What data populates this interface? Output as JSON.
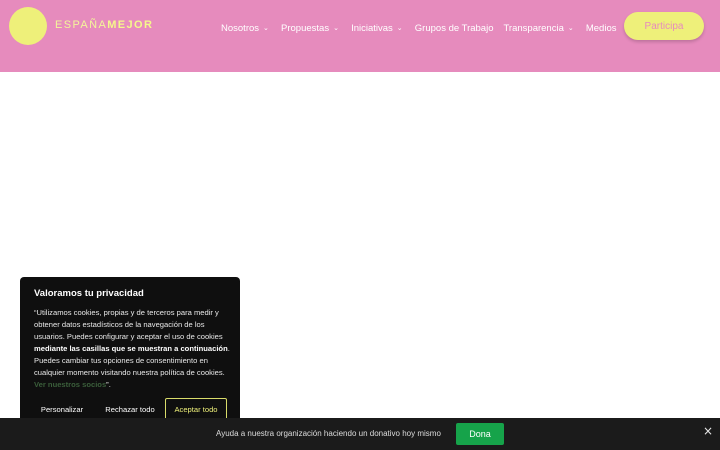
{
  "header": {
    "logo": {
      "part1": "ESPAÑA",
      "part2": "MEJOR"
    },
    "nav": [
      {
        "label": "Nosotros",
        "has_dropdown": true
      },
      {
        "label": "Propuestas",
        "has_dropdown": true
      },
      {
        "label": "Iniciativas",
        "has_dropdown": true
      },
      {
        "label": "Grupos de Trabajo",
        "has_dropdown": false
      },
      {
        "label": "Transparencia",
        "has_dropdown": true
      },
      {
        "label": "Medios",
        "has_dropdown": false
      }
    ],
    "cta_label": "Participa"
  },
  "cookie_banner": {
    "title": "Valoramos tu privacidad",
    "text_1": "“Utilizamos cookies, propias y de terceros para medir y obtener datos estadísticos de la navegación de los usuarios. Puedes configurar y aceptar el uso de cookies ",
    "text_bold_1": "mediante las casillas que se muestran a continuación",
    "text_2": ". Puedes cambiar tus opciones de consentimiento en cualquier momento visitando nuestra política de cookies. ",
    "link_label": "Ver nuestros socios",
    "text_3": "”.",
    "buttons": {
      "customize": "Personalizar",
      "reject": "Rechazar todo",
      "accept": "Aceptar todo"
    }
  },
  "donation_bar": {
    "text": "Ayuda a nuestra organización haciendo un donativo hoy mismo",
    "button_label": "Dona",
    "close_icon": "×"
  },
  "colors": {
    "header_bg": "#e68bbd",
    "accent_yellow": "#eef07a",
    "donate_green": "#16a34a",
    "banner_bg": "#0f0f0f"
  },
  "icons": {
    "chevron": "⌄"
  }
}
